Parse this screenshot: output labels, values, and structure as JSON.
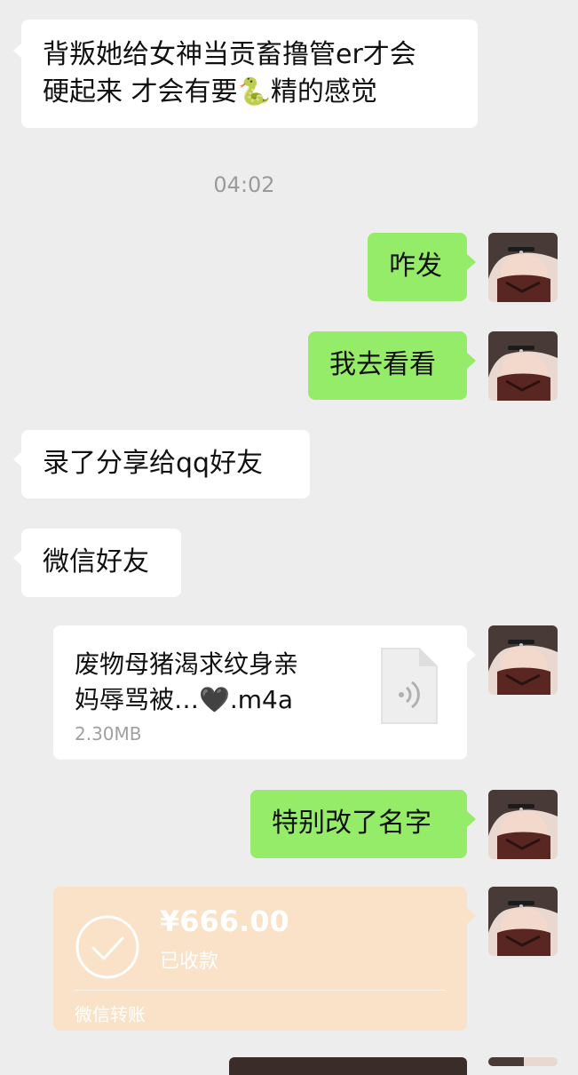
{
  "messages": {
    "m1": {
      "text_line1": "背叛她给女神当贡畜撸管er才会",
      "text_line2": "硬起来 才会有要🐍精的感觉"
    },
    "timestamp": "04:02",
    "m2": {
      "text": "咋发"
    },
    "m3": {
      "text": "我去看看"
    },
    "m4": {
      "text": "录了分享给qq好友"
    },
    "m5": {
      "text": "微信好友"
    },
    "m6": {
      "file_name_line1": "废物母猪渴求纹身亲",
      "file_name_line2": "妈辱骂被…🖤.m4a",
      "file_size": "2.30MB",
      "icon": "audio-file-icon"
    },
    "m7": {
      "text": "特别改了名字"
    },
    "m8": {
      "amount": "¥666.00",
      "status": "已收款",
      "label": "微信转账"
    }
  },
  "colors": {
    "background": "#ededed",
    "incoming_bubble": "#ffffff",
    "outgoing_bubble": "#95ec69",
    "transfer_card": "#f9e2c7",
    "timestamp_text": "#9b9b9b"
  }
}
